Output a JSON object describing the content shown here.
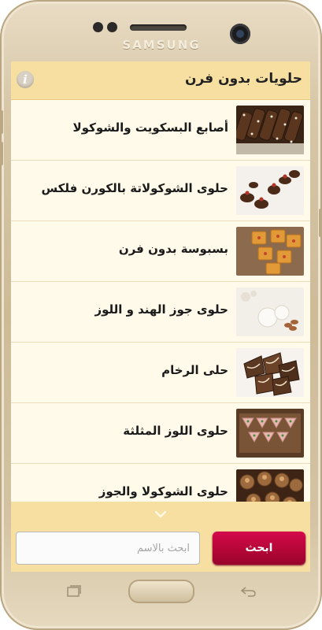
{
  "device": {
    "brand": "SAMSUNG"
  },
  "app": {
    "title": "حلويات بدون فرن",
    "info_icon": "i"
  },
  "list": {
    "items": [
      {
        "label": "أصابع البسكويت والشوكولا",
        "image": "chocolate-biscuit-fingers"
      },
      {
        "label": "حلوى الشوكولاتة بالكورن فلكس",
        "image": "chocolate-cornflakes-clusters"
      },
      {
        "label": "بسبوسة بدون فرن",
        "image": "basbousa-squares"
      },
      {
        "label": "حلوى جوز الهند و اللوز",
        "image": "coconut-almond-balls"
      },
      {
        "label": "حلى الرخام",
        "image": "marble-dessert-slices"
      },
      {
        "label": "حلوى اللوز المثلثة",
        "image": "triangle-almond-sweets"
      },
      {
        "label": "حلوى الشوكولا والجوز",
        "image": "chocolate-walnut-sweets"
      }
    ]
  },
  "search": {
    "placeholder": "ابحث بالاسم",
    "value": "",
    "button_label": "ابحث"
  },
  "colors": {
    "accent_bar": "#f7dfa2",
    "list_background": "#fffaea",
    "search_button": "#b50638"
  }
}
